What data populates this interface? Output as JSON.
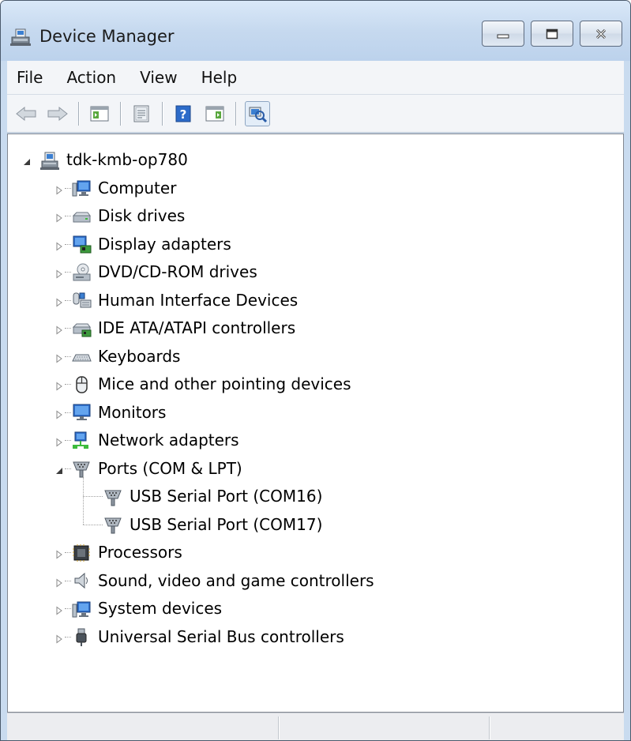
{
  "window": {
    "title": "Device Manager",
    "controls": [
      "minimize",
      "maximize",
      "close"
    ]
  },
  "menu": {
    "items": [
      "File",
      "Action",
      "View",
      "Help"
    ]
  },
  "toolbar": {
    "buttons": [
      "back-arrow-icon",
      "forward-arrow-icon",
      "show-hide-console-tree-icon",
      "properties-icon",
      "help-icon",
      "action-pane-icon",
      "scan-hardware-icon"
    ]
  },
  "tree": {
    "root": "tdk-kmb-op780",
    "categories": [
      {
        "label": "Computer",
        "icon": "computer-icon",
        "expanded": false
      },
      {
        "label": "Disk drives",
        "icon": "disk-drive-icon",
        "expanded": false
      },
      {
        "label": "Display adapters",
        "icon": "display-adapter-icon",
        "expanded": false
      },
      {
        "label": "DVD/CD-ROM drives",
        "icon": "dvd-drive-icon",
        "expanded": false
      },
      {
        "label": "Human Interface Devices",
        "icon": "hid-icon",
        "expanded": false
      },
      {
        "label": "IDE ATA/ATAPI controllers",
        "icon": "ide-controller-icon",
        "expanded": false
      },
      {
        "label": "Keyboards",
        "icon": "keyboard-icon",
        "expanded": false
      },
      {
        "label": "Mice and other pointing devices",
        "icon": "mouse-icon",
        "expanded": false
      },
      {
        "label": "Monitors",
        "icon": "monitor-icon",
        "expanded": false
      },
      {
        "label": "Network adapters",
        "icon": "network-adapter-icon",
        "expanded": false
      },
      {
        "label": "Ports (COM & LPT)",
        "icon": "port-icon",
        "expanded": true,
        "children": [
          "USB Serial Port (COM16)",
          "USB Serial Port (COM17)"
        ]
      },
      {
        "label": "Processors",
        "icon": "processor-icon",
        "expanded": false
      },
      {
        "label": "Sound, video and game controllers",
        "icon": "speaker-icon",
        "expanded": false
      },
      {
        "label": "System devices",
        "icon": "system-device-icon",
        "expanded": false
      },
      {
        "label": "Universal Serial Bus controllers",
        "icon": "usb-icon",
        "expanded": false
      }
    ]
  },
  "colors": {
    "titlebar": "#c6d9ef",
    "window_frame": "#c9dbef",
    "accent_blue": "#1f6fd0"
  }
}
